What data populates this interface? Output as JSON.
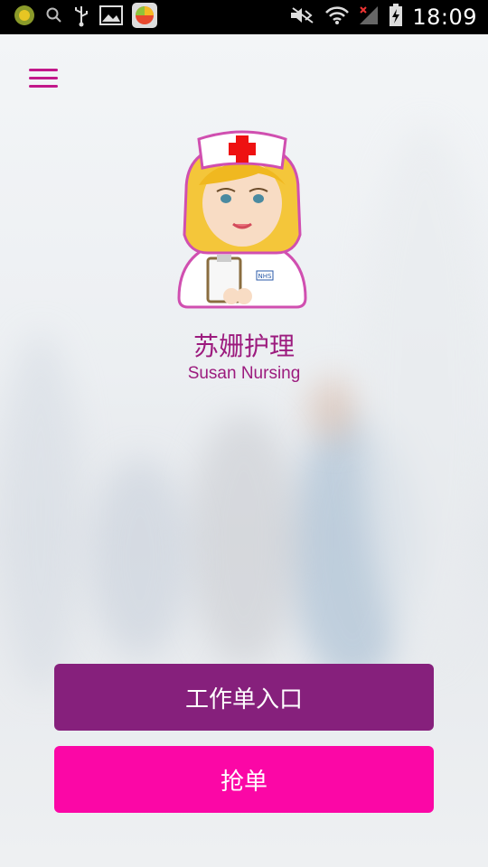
{
  "status_bar": {
    "time": "18:09",
    "icons": [
      "app-notification-icon",
      "search-icon",
      "usb-icon",
      "gallery-icon",
      "app-badge-icon",
      "mute-icon",
      "wifi-icon",
      "signal-icon",
      "battery-charging-icon"
    ]
  },
  "header": {
    "menu_icon": "hamburger-menu-icon"
  },
  "brand": {
    "name_cn": "苏姗护理",
    "name_en": "Susan Nursing",
    "badge_text": "NHS"
  },
  "actions": {
    "work_order_label": "工作单入口",
    "grab_order_label": "抢单"
  },
  "colors": {
    "accent_purple": "#86207c",
    "accent_pink": "#fb07a6",
    "brand_text": "#9c1b7e"
  }
}
